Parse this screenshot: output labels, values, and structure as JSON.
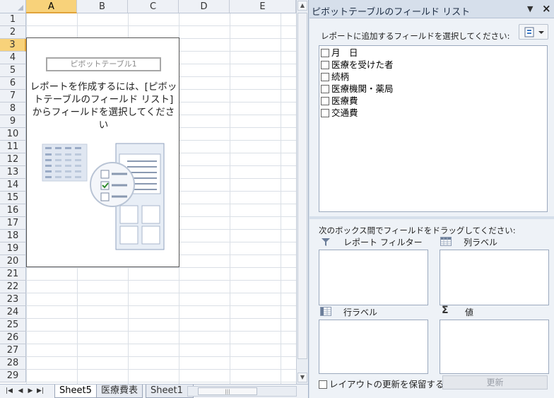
{
  "sheet": {
    "columns": [
      "A",
      "B",
      "C",
      "D",
      "E"
    ],
    "selected_column": "A",
    "rows": [
      "1",
      "2",
      "3",
      "4",
      "5",
      "6",
      "7",
      "8",
      "9",
      "10",
      "11",
      "12",
      "13",
      "14",
      "15",
      "16",
      "17",
      "18",
      "19",
      "20",
      "21",
      "22",
      "23",
      "24",
      "25",
      "26",
      "27",
      "28",
      "29"
    ],
    "selected_row": "3",
    "pivot_name": "ピボットテーブル1",
    "pivot_message": "レポートを作成するには、[ピボットテーブルのフィールド リスト] からフィールドを選択してください"
  },
  "tabs": {
    "sheets": [
      "Sheet5",
      "医療費表",
      "Sheet1"
    ],
    "active_index": 0
  },
  "pane": {
    "title": "ピボットテーブルのフィールド リスト",
    "choose_label": "レポートに追加するフィールドを選択してください:",
    "fields": [
      {
        "label": "月　日",
        "checked": false
      },
      {
        "label": "医療を受けた者",
        "checked": false
      },
      {
        "label": "続柄",
        "checked": false
      },
      {
        "label": "医療機関・薬局",
        "checked": false
      },
      {
        "label": "医療費",
        "checked": false
      },
      {
        "label": "交通費",
        "checked": false
      }
    ],
    "drag_label": "次のボックス間でフィールドをドラッグしてください:",
    "areas": {
      "report_filter": "レポート フィルター",
      "column_labels": "列ラベル",
      "row_labels": "行ラベル",
      "values": "値"
    },
    "defer_label": "レイアウトの更新を保留する",
    "update_label": "更新"
  },
  "icons": {
    "pane_menu": "chevron-down-icon",
    "pane_close": "close-icon",
    "layout": "layout-options-icon",
    "filter": "filter-icon",
    "columns": "column-labels-icon",
    "rows": "row-labels-icon",
    "values": "sigma-icon"
  },
  "colors": {
    "selected_header": "#f8d27a",
    "pane_background": "#d6dfeb"
  }
}
